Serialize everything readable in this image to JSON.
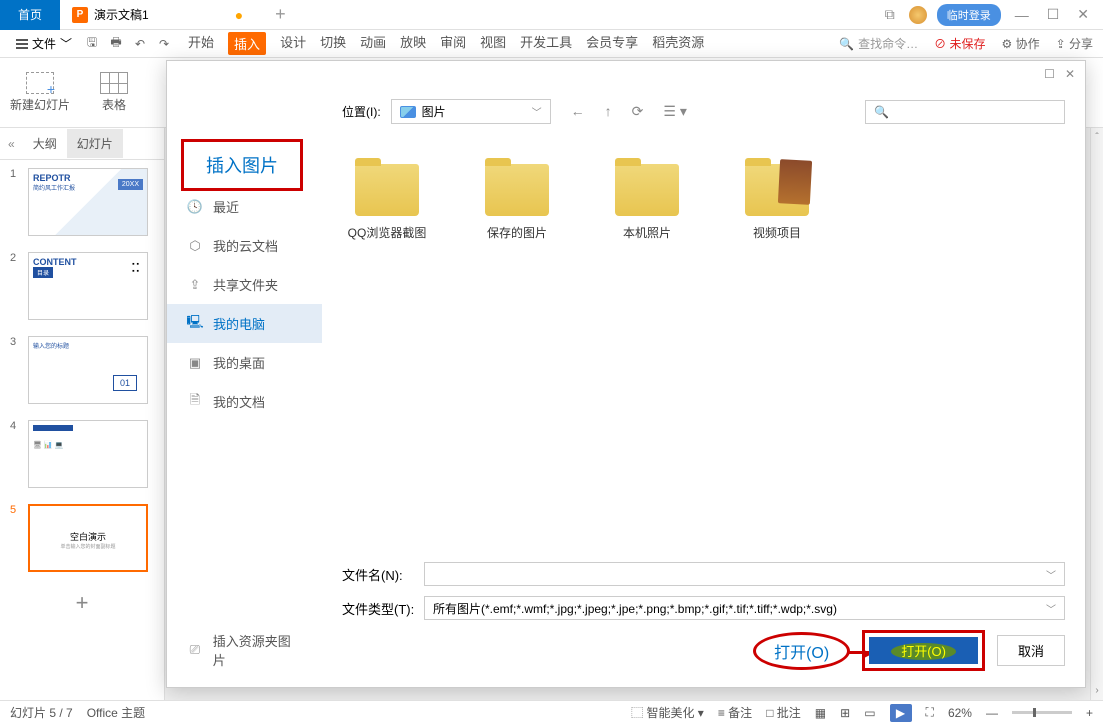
{
  "titlebar": {
    "home_tab": "首页",
    "doc_tab": "演示文稿1",
    "doc_icon_letter": "P",
    "login_btn": "临时登录"
  },
  "menubar": {
    "file": "文件",
    "items": [
      "开始",
      "插入",
      "设计",
      "切换",
      "动画",
      "放映",
      "审阅",
      "视图",
      "开发工具",
      "会员专享",
      "稻壳资源"
    ],
    "search_placeholder": "查找命令…",
    "unsaved": "未保存",
    "collab": "协作",
    "share": "分享"
  },
  "ribbon": {
    "new_slide": "新建幻灯片",
    "table": "表格"
  },
  "left_panel": {
    "tabs": {
      "outline": "大纲",
      "slides": "幻灯片"
    },
    "slides": [
      {
        "num": "1",
        "title": "REPOTR",
        "sub": "简约风工作汇报",
        "year": "20XX"
      },
      {
        "num": "2",
        "title": "CONTENT",
        "sub": "目录"
      },
      {
        "num": "3",
        "title": "输入您的标题",
        "badge": "01"
      },
      {
        "num": "4",
        "title": ""
      },
      {
        "num": "5",
        "title": "空白演示"
      }
    ]
  },
  "dialog": {
    "title": "插入图片",
    "location_label": "位置(I):",
    "location_value": "图片",
    "search_placeholder": "Q",
    "sidebar": {
      "recent": "最近",
      "cloud": "我的云文档",
      "shared": "共享文件夹",
      "computer": "我的电脑",
      "desktop": "我的桌面",
      "documents": "我的文档",
      "resource": "插入资源夹图片"
    },
    "folders": [
      "QQ浏览器截图",
      "保存的图片",
      "本机照片",
      "视频项目"
    ],
    "filename_label": "文件名(N):",
    "filename_value": "",
    "filetype_label": "文件类型(T):",
    "filetype_value": "所有图片(*.emf;*.wmf;*.jpg;*.jpeg;*.jpe;*.png;*.bmp;*.gif;*.tif;*.tiff;*.wdp;*.svg)",
    "open_callout": "打开(O)",
    "open_btn": "打开(O)",
    "cancel_btn": "取消"
  },
  "statusbar": {
    "slide_info": "幻灯片 5 / 7",
    "theme": "Office 主题",
    "beautify": "智能美化",
    "notes": "备注",
    "comments": "批注",
    "zoom": "62%"
  }
}
